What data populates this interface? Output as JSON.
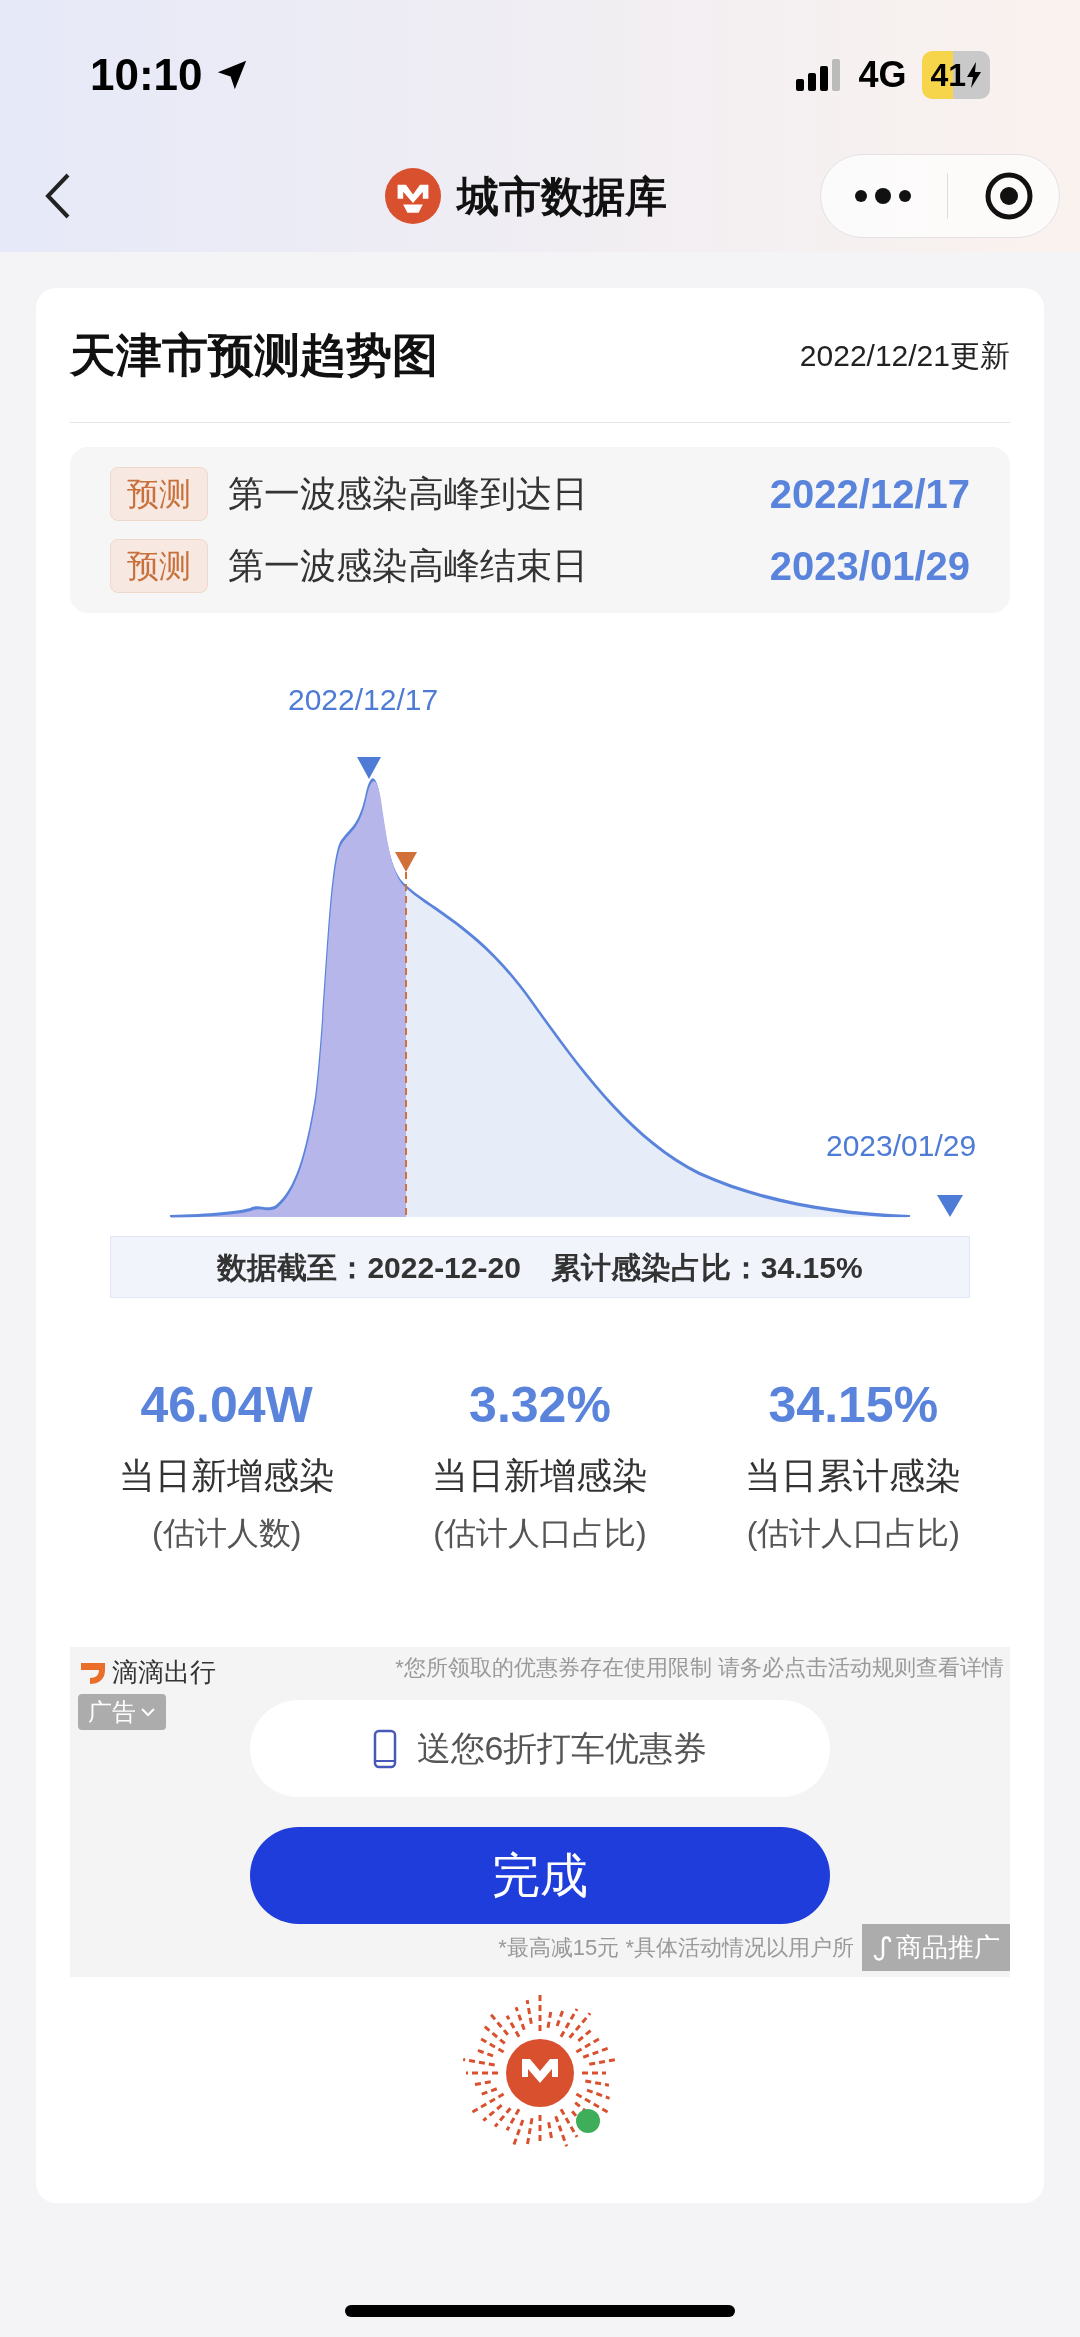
{
  "status_bar": {
    "time": "10:10",
    "network": "4G",
    "battery": "41"
  },
  "nav": {
    "title": "城市数据库"
  },
  "card": {
    "title": "天津市预测趋势图",
    "updated": "2022/12/21更新"
  },
  "predictions": [
    {
      "tag": "预测",
      "label": "第一波感染高峰到达日",
      "date": "2022/12/17"
    },
    {
      "tag": "预测",
      "label": "第一波感染高峰结束日",
      "date": "2023/01/29"
    }
  ],
  "chart": {
    "peak_label": "2022/12/17",
    "end_label": "2023/01/29"
  },
  "data_note": [
    "数据截至：2022-12-20",
    "累计感染占比：34.15%"
  ],
  "stats": [
    {
      "value": "46.04W",
      "label": "当日新增感染",
      "sub": "(估计人数)"
    },
    {
      "value": "3.32%",
      "label": "当日新增感染",
      "sub": "(估计人口占比)"
    },
    {
      "value": "34.15%",
      "label": "当日累计感染",
      "sub": "(估计人口占比)"
    }
  ],
  "ad": {
    "brand": "滴滴出行",
    "ad_tag": "广告",
    "top_note": "*您所领取的优惠券存在使用限制 请务必点击活动规则查看详情",
    "coupon": "送您6折打车优惠券",
    "button": "完成",
    "bottom_note": "*最高减15元 *具体活动情况以用户所",
    "promo_tag": "商品推广"
  }
}
